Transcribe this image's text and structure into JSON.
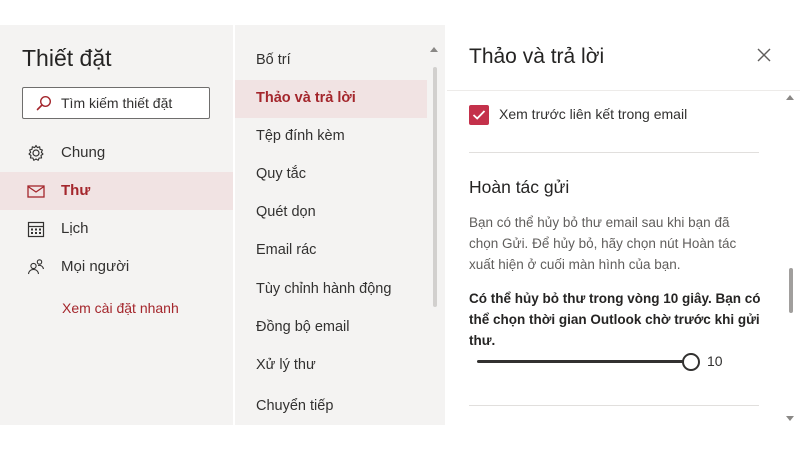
{
  "settings": {
    "title": "Thiết đặt",
    "search": {
      "placeholder": "Tìm kiếm thiết đặt"
    },
    "nav": [
      {
        "label": "Chung",
        "icon": "gear-icon"
      },
      {
        "label": "Thư",
        "icon": "mail-icon",
        "active": true
      },
      {
        "label": "Lịch",
        "icon": "calendar-icon"
      },
      {
        "label": "Mọi người",
        "icon": "people-icon"
      }
    ],
    "quick_settings_link": "Xem cài đặt nhanh"
  },
  "mail_menu": {
    "items": [
      "Bố trí",
      "Thảo và trả lời",
      "Tệp đính kèm",
      "Quy tắc",
      "Quét dọn",
      "Email rác",
      "Tùy chỉnh hành động",
      "Đồng bộ email",
      "Xử lý thư",
      "Chuyển tiếp"
    ],
    "active_index": 1
  },
  "panel": {
    "title": "Thảo và trả lời",
    "link_preview": {
      "label": "Xem trước liên kết trong email",
      "checked": true
    },
    "undo_send": {
      "title": "Hoàn tác gửi",
      "description": "Bạn có thể hủy bỏ thư email sau khi bạn đã chọn Gửi. Để hủy bỏ, hãy chọn nút Hoàn tác xuất hiện ở cuối màn hình của bạn.",
      "bold_text": "Có thể hủy bỏ thư trong vòng 10 giây. Bạn có thể chọn thời gian Outlook chờ trước khi gửi thư.",
      "slider_value": "10",
      "slider_fraction": 1.0
    }
  },
  "colors": {
    "accent": "#a4262c",
    "checkbox": "#c4314b",
    "active_bg": "#f1e3e3",
    "sidebar_bg": "#f4f3f2"
  }
}
